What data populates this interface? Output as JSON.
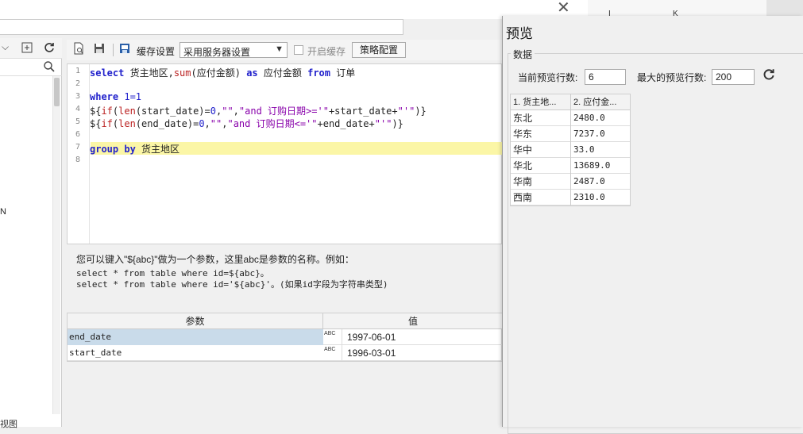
{
  "topbar": {
    "close_glyph": "✕"
  },
  "left_panel": {
    "chevron": "⌵",
    "bottom_label": "视图",
    "side_letter": "N"
  },
  "toolbar": {
    "cache_label": "缓存设置",
    "cache_select_value": "采用服务器设置",
    "enable_cache_label": "开启缓存",
    "strategy_button": "策略配置"
  },
  "editor": {
    "line_numbers": [
      "1",
      "2",
      "3",
      "4",
      "5",
      "6",
      "7",
      "8"
    ]
  },
  "hint": {
    "line1": "您可以键入\"${abc}\"做为一个参数，这里abc是参数的名称。例如：",
    "line2": "select * from table where id=${abc}。",
    "line3": "select * from table where id='${abc}'。(如果id字段为字符串类型)"
  },
  "params": {
    "header_name": "参数",
    "header_value": "值",
    "type_label": "ABC",
    "rows": [
      {
        "name": "end_date",
        "value": "1997-06-01"
      },
      {
        "name": "start_date",
        "value": "1996-03-01"
      }
    ]
  },
  "background_right": {
    "col_i": "I",
    "col_k": "K"
  },
  "preview": {
    "title": "预览",
    "group_label": "数据",
    "current_rows_label": "当前预览行数:",
    "current_rows_value": "6",
    "max_rows_label": "最大的预览行数:",
    "max_rows_value": "200",
    "columns": [
      "1. 货主地...",
      "2. 应付金..."
    ],
    "rows": [
      [
        "东北",
        "2480.0"
      ],
      [
        "华东",
        "7237.0"
      ],
      [
        "华中",
        "33.0"
      ],
      [
        "华北",
        "13689.0"
      ],
      [
        "华南",
        "2487.0"
      ],
      [
        "西南",
        "2310.0"
      ]
    ]
  }
}
